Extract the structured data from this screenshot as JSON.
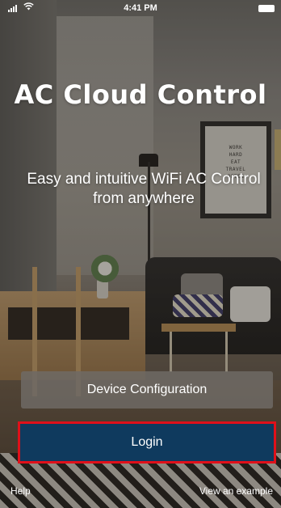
{
  "status_bar": {
    "time": "4:41 PM",
    "signal_icon": "signal-bars-icon",
    "wifi_icon": "wifi-icon",
    "battery_icon": "battery-icon"
  },
  "app": {
    "title": "AC Cloud Control",
    "subtitle": "Easy and intuitive WiFi AC Control from anywhere"
  },
  "background": {
    "poster_text": "WORK\nHARD\nEAT\nTRAVEL\nOFTEN"
  },
  "buttons": {
    "device_configuration": "Device Configuration",
    "login": "Login"
  },
  "footer": {
    "help": "Help",
    "view_example": "View an example"
  },
  "colors": {
    "login_button": "#0f3a5e",
    "highlight_border": "#e0101a",
    "config_button": "#6e6a65"
  }
}
